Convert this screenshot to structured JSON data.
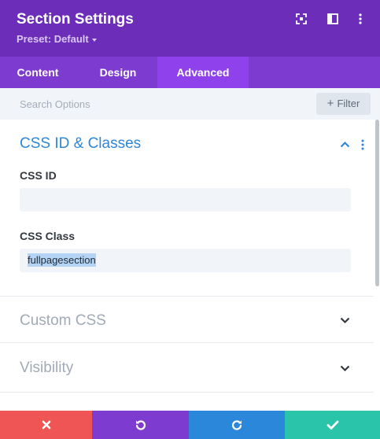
{
  "header": {
    "title": "Section Settings",
    "preset": "Preset: Default"
  },
  "tabs": [
    {
      "label": "Content",
      "active": false
    },
    {
      "label": "Design",
      "active": false
    },
    {
      "label": "Advanced",
      "active": true
    }
  ],
  "search": {
    "placeholder": "Search Options",
    "filter_label": "Filter"
  },
  "sections": {
    "css_id_classes": {
      "title": "CSS ID & Classes",
      "expanded": true,
      "css_id_label": "CSS ID",
      "css_id_value": "",
      "css_class_label": "CSS Class",
      "css_class_value": "fullpagesection"
    },
    "custom_css": {
      "title": "Custom CSS",
      "expanded": false
    },
    "visibility": {
      "title": "Visibility",
      "expanded": false
    }
  },
  "colors": {
    "header": "#6c2eb9",
    "tabs": "#7e3bd0",
    "active_tab": "#8f42ec",
    "accent": "#2d87d8",
    "discard": "#ef5555",
    "undo": "#7e3bd0",
    "redo": "#2b87da",
    "save": "#29c4a9"
  },
  "icons": {
    "expand": "expand-icon",
    "sidebar": "sidebar-toggle-icon",
    "more": "more-vertical-icon",
    "discard": "close-icon",
    "undo": "undo-icon",
    "redo": "redo-icon",
    "save": "check-icon"
  }
}
